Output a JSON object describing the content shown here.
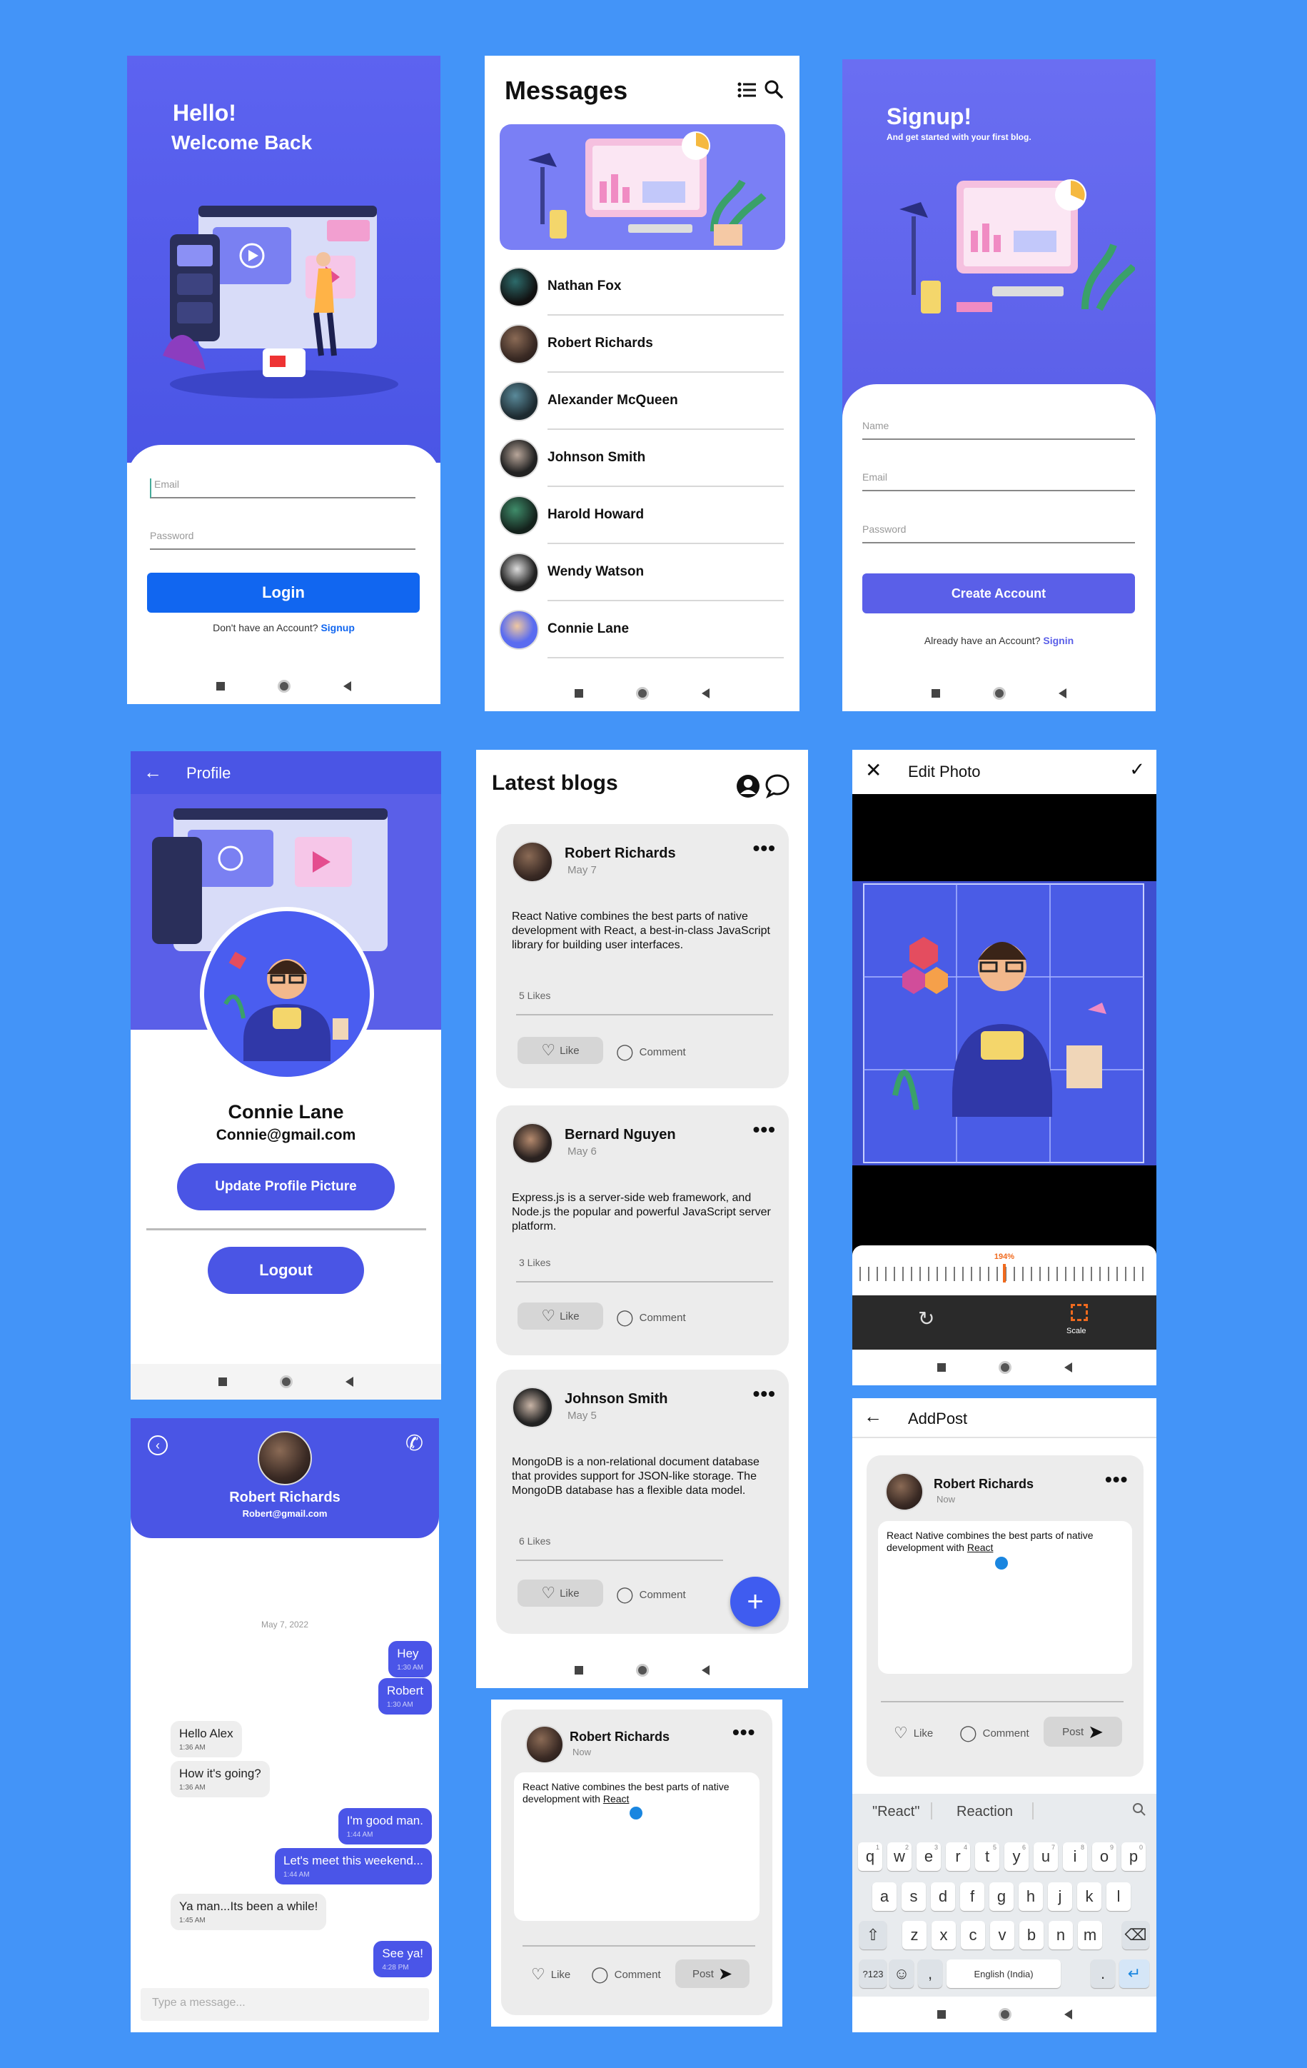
{
  "login": {
    "greeting": "Hello!",
    "subtitle": "Welcome Back",
    "email_placeholder": "Email",
    "password_placeholder": "Password",
    "login_button": "Login",
    "no_account": "Don't have an Account?",
    "signup_link": "Signup"
  },
  "messages": {
    "title": "Messages",
    "contacts": [
      "Nathan Fox",
      "Robert Richards",
      "Alexander McQueen",
      "Johnson Smith",
      "Harold Howard",
      "Wendy Watson",
      "Connie Lane"
    ]
  },
  "signup": {
    "title": "Signup!",
    "subtitle": "And get started with your first blog.",
    "name_placeholder": "Name",
    "email_placeholder": "Email",
    "password_placeholder": "Password",
    "create_button": "Create Account",
    "have_account": "Already have an Account?",
    "signin_link": "Signin"
  },
  "profile": {
    "header": "Profile",
    "name": "Connie Lane",
    "email": "Connie@gmail.com",
    "update_button": "Update Profile Picture",
    "logout_button": "Logout"
  },
  "blogs": {
    "title": "Latest blogs",
    "posts": [
      {
        "author": "Robert Richards",
        "date": "May 7",
        "text": "React Native combines the best parts of native development with React, a best-in-class JavaScript library for building user interfaces.",
        "likes": "5 Likes"
      },
      {
        "author": "Bernard Nguyen",
        "date": "May 6",
        "text": "Express.js is a server-side web framework, and Node.js the popular and powerful JavaScript server platform.",
        "likes": "3 Likes"
      },
      {
        "author": "Johnson Smith",
        "date": "May 5",
        "text": "MongoDB is a non-relational document database that provides support for JSON-like storage. The MongoDB database has a flexible data model.",
        "likes": "6 Likes"
      }
    ],
    "like_label": "Like",
    "comment_label": "Comment",
    "fab": "+"
  },
  "edit_photo": {
    "title": "Edit Photo",
    "zoom": "194%",
    "scale_label": "Scale"
  },
  "chat": {
    "name": "Robert Richards",
    "email": "Robert@gmail.com",
    "date": "May 7, 2022",
    "messages": [
      {
        "text": "Hey",
        "time": "1:30 AM"
      },
      {
        "text": "Robert",
        "time": "1:30 AM"
      },
      {
        "text": "Hello Alex",
        "time": "1:36 AM"
      },
      {
        "text": "How it's going?",
        "time": "1:36 AM"
      },
      {
        "text": "I'm good man.",
        "time": "1:44 AM"
      },
      {
        "text": "Let's meet this weekend...",
        "time": "1:44 AM"
      },
      {
        "text": "Ya man...Its been a while!",
        "time": "1:45 AM"
      },
      {
        "text": "See ya!",
        "time": "4:28 PM"
      }
    ],
    "input_placeholder": "Type a message..."
  },
  "compose": {
    "author": "Robert Richards",
    "time": "Now",
    "text_before": "React Native combines the best parts of native development with ",
    "text_link": "React",
    "like_label": "Like",
    "comment_label": "Comment",
    "post_label": "Post"
  },
  "addpost": {
    "title": "AddPost",
    "author": "Robert Richards",
    "time": "Now",
    "text_before": "React Native combines the best parts of native development with ",
    "text_link": "React",
    "like_label": "Like",
    "comment_label": "Comment",
    "post_label": "Post",
    "suggestions": [
      "\"React\"",
      "Reaction"
    ],
    "row1": [
      "q",
      "w",
      "e",
      "r",
      "t",
      "y",
      "u",
      "i",
      "o",
      "p"
    ],
    "row1_hint": [
      "1",
      "2",
      "3",
      "4",
      "5",
      "6",
      "7",
      "8",
      "9",
      "0"
    ],
    "row2": [
      "a",
      "s",
      "d",
      "f",
      "g",
      "h",
      "j",
      "k",
      "l"
    ],
    "row3": [
      "z",
      "x",
      "c",
      "v",
      "b",
      "n",
      "m"
    ],
    "sym_key": "?123",
    "comma": ",",
    "space": "English (India)",
    "period": "."
  },
  "colors": {
    "background": "#4394f8",
    "purple": "#5a5fe8",
    "blue_button": "#1166f0",
    "bubble": "#4a55e8"
  }
}
